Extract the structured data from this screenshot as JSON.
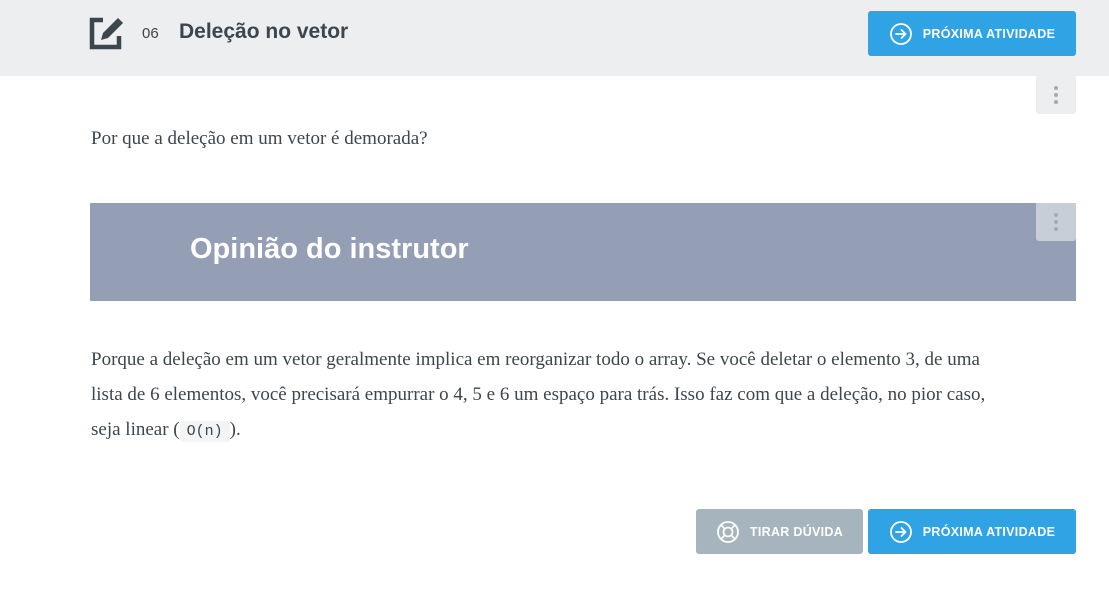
{
  "header": {
    "task_number": "06",
    "task_title": "Deleção no vetor",
    "icon": "edit-task-icon"
  },
  "actions": {
    "next_label": "PRÓXIMA ATIVIDADE",
    "doubt_label": "TIRAR DÚVIDA"
  },
  "content": {
    "question": "Por que a deleção em um vetor é demorada?",
    "instructor_title": "Opinião do instrutor",
    "answer_before": "Porque a deleção em um vetor geralmente implica em reorganizar todo o array. Se você deletar o elemento 3, de uma lista de 6 elementos, você precisará empurrar o 4, 5 e 6 um espaço para trás. Isso faz com que a deleção, no pior caso, seja linear (",
    "answer_code": "O(n)",
    "answer_after": ")."
  },
  "colors": {
    "accent": "#2fa3e3",
    "secondary_button": "#a5b4bd",
    "banner": "#949eb5",
    "topbar": "#eceef0"
  }
}
